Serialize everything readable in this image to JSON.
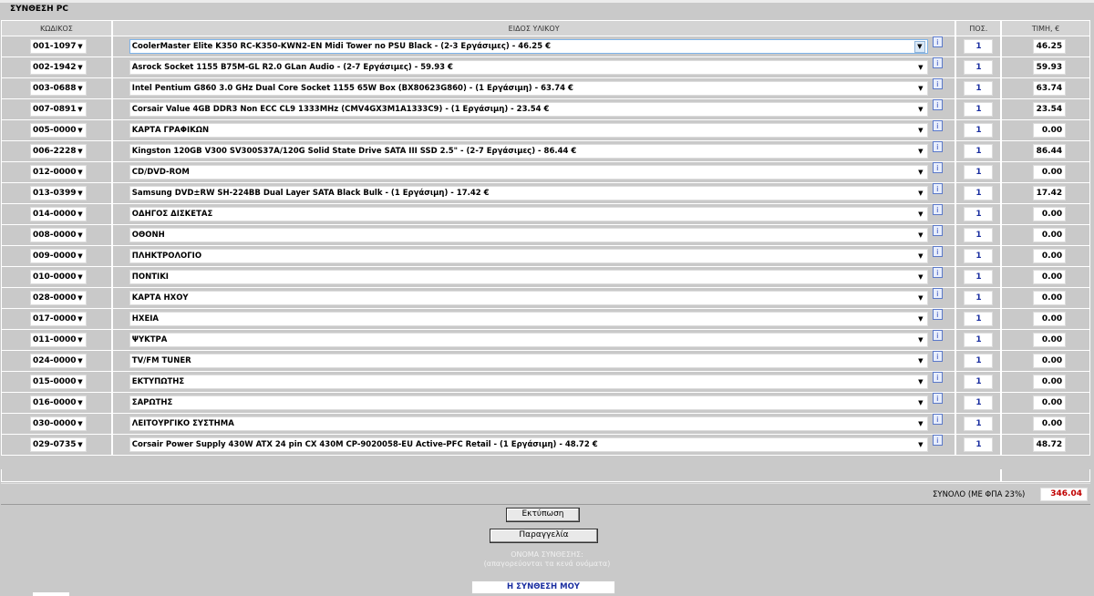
{
  "title": "ΣΥΝΘΕΣΗ PC",
  "headers": {
    "code": "ΚΩΔΙΚΟΣ",
    "description": "ΕΙΔΟΣ ΥΛΙΚΟΥ",
    "qty": "ΠΟΣ.",
    "price": "ΤΙΜΗ, €"
  },
  "rows": [
    {
      "code": "001-1097",
      "description": "CoolerMaster Elite K350 RC-K350-KWN2-EN Midi Tower no PSU Black - (2-3 Εργάσιμες) - 46.25 €",
      "qty": "1",
      "price": "46.25"
    },
    {
      "code": "002-1942",
      "description": "Asrock Socket 1155 B75M-GL R2.0 GLan Audio - (2-7 Εργάσιμες) - 59.93 €",
      "qty": "1",
      "price": "59.93"
    },
    {
      "code": "003-0688",
      "description": "Intel Pentium G860 3.0 GHz Dual Core Socket 1155 65W Box (BX80623G860) - (1 Εργάσιμη) - 63.74 €",
      "qty": "1",
      "price": "63.74"
    },
    {
      "code": "007-0891",
      "description": "Corsair Value 4GB DDR3 Non ECC CL9 1333MHz (CMV4GX3M1A1333C9) - (1 Εργάσιμη) - 23.54 €",
      "qty": "1",
      "price": "23.54"
    },
    {
      "code": "005-0000",
      "description": "ΚΑΡΤΑ ΓΡΑΦΙΚΩΝ",
      "qty": "1",
      "price": "0.00"
    },
    {
      "code": "006-2228",
      "description": "Kingston 120GB V300 SV300S37A/120G Solid State Drive SATA III SSD 2.5\" - (2-7 Εργάσιμες) - 86.44 €",
      "qty": "1",
      "price": "86.44"
    },
    {
      "code": "012-0000",
      "description": "CD/DVD-ROM",
      "qty": "1",
      "price": "0.00"
    },
    {
      "code": "013-0399",
      "description": "Samsung DVD±RW SH-224BB Dual Layer SATA Black Bulk - (1 Εργάσιμη) - 17.42 €",
      "qty": "1",
      "price": "17.42"
    },
    {
      "code": "014-0000",
      "description": "ΟΔΗΓΟΣ ΔΙΣΚΕΤΑΣ",
      "qty": "1",
      "price": "0.00"
    },
    {
      "code": "008-0000",
      "description": "ΟΘΟΝΗ",
      "qty": "1",
      "price": "0.00"
    },
    {
      "code": "009-0000",
      "description": "ΠΛΗΚΤΡΟΛΟΓΙΟ",
      "qty": "1",
      "price": "0.00"
    },
    {
      "code": "010-0000",
      "description": "ΠΟΝΤΙΚΙ",
      "qty": "1",
      "price": "0.00"
    },
    {
      "code": "028-0000",
      "description": "ΚΑΡΤΑ ΗΧΟΥ",
      "qty": "1",
      "price": "0.00"
    },
    {
      "code": "017-0000",
      "description": "ΗΧΕΙΑ",
      "qty": "1",
      "price": "0.00"
    },
    {
      "code": "011-0000",
      "description": "ΨΥΚΤΡΑ",
      "qty": "1",
      "price": "0.00"
    },
    {
      "code": "024-0000",
      "description": "TV/FM TUNER",
      "qty": "1",
      "price": "0.00"
    },
    {
      "code": "015-0000",
      "description": "ΕΚΤΥΠΩΤΗΣ",
      "qty": "1",
      "price": "0.00"
    },
    {
      "code": "016-0000",
      "description": "ΣΑΡΩΤΗΣ",
      "qty": "1",
      "price": "0.00"
    },
    {
      "code": "030-0000",
      "description": "ΛΕΙΤΟΥΡΓΙΚΟ ΣΥΣΤΗΜΑ",
      "qty": "1",
      "price": "0.00"
    },
    {
      "code": "029-0735",
      "description": "Corsair Power Supply 430W ATX 24 pin CX 430M CP-9020058-EU Active-PFC Retail - (1 Εργάσιμη) - 48.72 €",
      "qty": "1",
      "price": "48.72"
    }
  ],
  "icons": {
    "dropdown": "chevron-down-icon",
    "info": "info-icon"
  },
  "info_label": "i",
  "total": {
    "label": "ΣΥΝΟΛΟ (ΜΕ ΦΠΑ 23%)",
    "value": "346.04"
  },
  "buttons": {
    "print": "Εκτύπωση",
    "order": "Παραγγελία"
  },
  "composition": {
    "title": "ΟΝΟΜΑ ΣΥΝΘΕΣΗΣ:",
    "subtitle": "(απαγορεύονται τα κενά ονόματα)",
    "value": "Η ΣΥΝΘΕΣΗ ΜΟΥ"
  },
  "colors": {
    "total_value": "#c00000",
    "qty_text": "#1a2ea0",
    "panel_bg": "#c9c9c9"
  }
}
